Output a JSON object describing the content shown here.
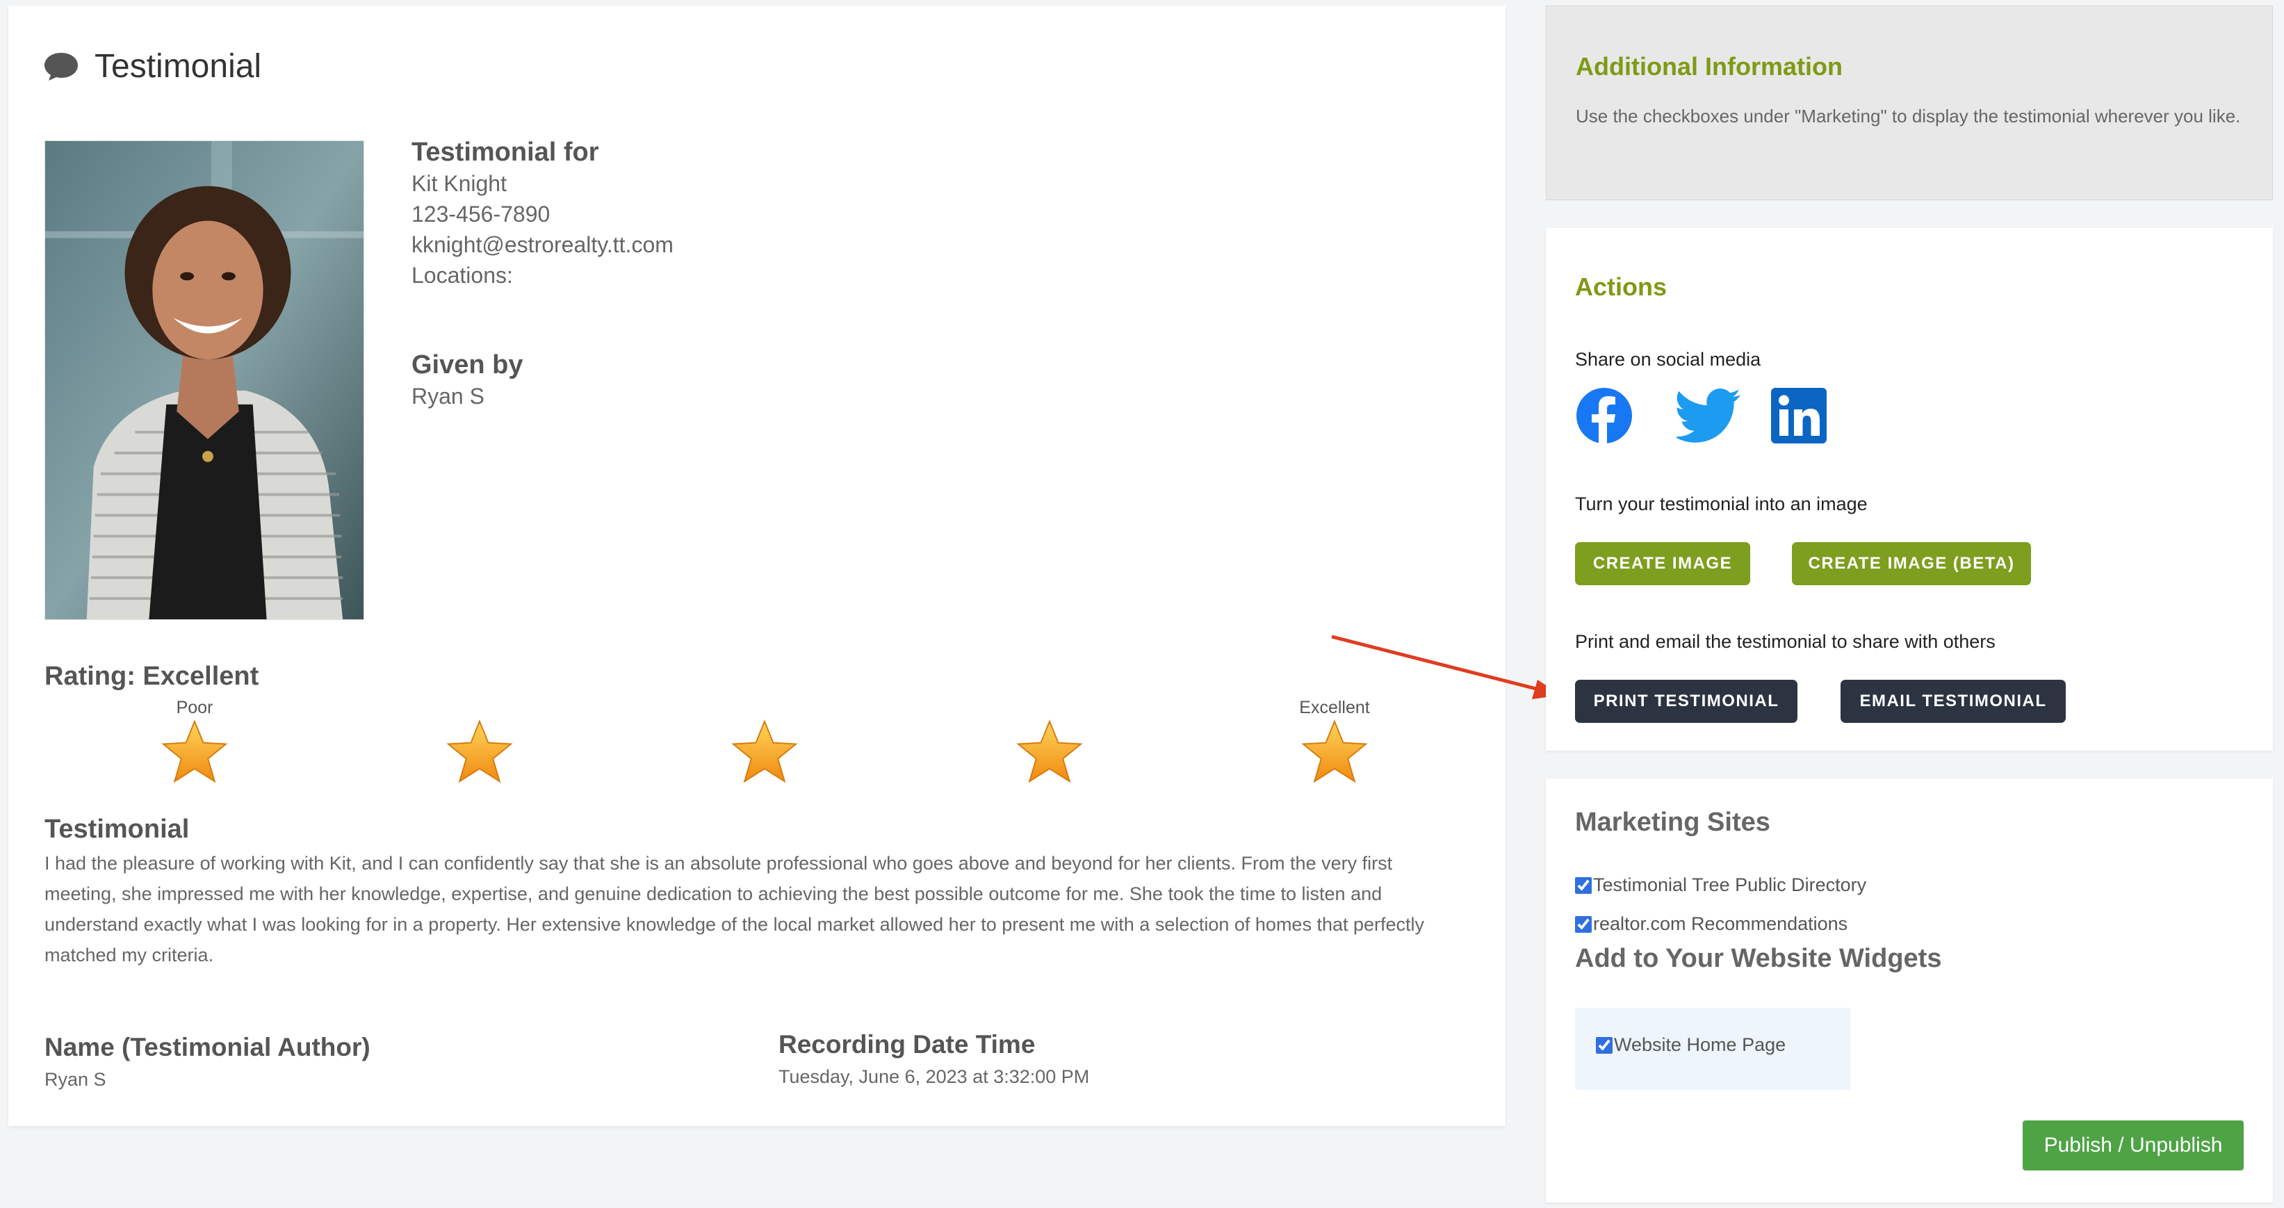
{
  "page": {
    "title": "Testimonial"
  },
  "recipient": {
    "heading": "Testimonial for",
    "name": "Kit Knight",
    "phone": "123-456-7890",
    "email": "kknight@estrorealty.tt.com",
    "locations_label": "Locations:"
  },
  "giver": {
    "heading": "Given by",
    "name": "Ryan S"
  },
  "rating": {
    "label": "Rating: Excellent",
    "low_caption": "Poor",
    "high_caption": "Excellent",
    "stars": 5,
    "max": 5,
    "star_color": "#f5a623"
  },
  "testimonial": {
    "heading": "Testimonial",
    "lines": [
      "I had the pleasure of working with Kit, and I can confidently say that she is an absolute professional who goes above and beyond for her clients. From the very first",
      "meeting, she impressed me with her knowledge, expertise, and genuine dedication to achieving the best possible outcome for me. She took the time to listen and",
      "understand exactly what I was looking for in a property. Her extensive knowledge of the local market allowed her to present me with a selection of homes that perfectly",
      "matched my criteria."
    ]
  },
  "author": {
    "heading": "Name (Testimonial Author)",
    "value": "Ryan S"
  },
  "recording": {
    "heading": "Recording Date Time",
    "value": "Tuesday, June 6, 2023 at 3:32:00 PM"
  },
  "additional_info": {
    "heading": "Additional Information",
    "description": "Use the checkboxes under \"Marketing\" to display the testimonial wherever you like."
  },
  "actions": {
    "heading": "Actions",
    "share_label": "Share on social media",
    "social_icons": [
      "facebook-icon",
      "twitter-icon",
      "linkedin-icon"
    ],
    "image_label": "Turn your testimonial into an image",
    "create_image": "CREATE IMAGE",
    "create_image_beta": "CREATE IMAGE (BETA)",
    "print_label": "Print and email the testimonial to share with others",
    "print_testimonial": "PRINT TESTIMONIAL",
    "email_testimonial": "EMAIL TESTIMONIAL"
  },
  "marketing": {
    "heading": "Marketing Sites",
    "sites": [
      {
        "label": "Testimonial Tree Public Directory",
        "checked": true
      },
      {
        "label": "realtor.com Recommendations",
        "checked": true
      }
    ],
    "widgets_heading": "Add to Your Website Widgets",
    "widgets": [
      {
        "label": "Website Home Page",
        "checked": true
      }
    ],
    "publish_button": "Publish / Unpublish"
  },
  "colors": {
    "accent_green": "#7e9a15",
    "button_green": "#7e9e1f",
    "button_dark": "#2c3441",
    "publish_green": "#4ea345",
    "annotation_arrow": "#e03c1f"
  }
}
